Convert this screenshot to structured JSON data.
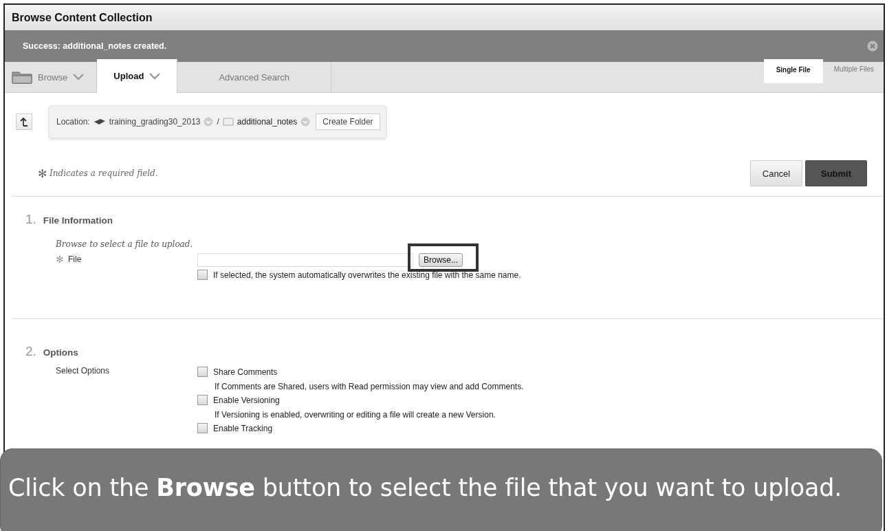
{
  "window": {
    "title": "Browse Content Collection"
  },
  "notification": {
    "message": "Success: additional_notes created.",
    "closable": true
  },
  "tabs": [
    {
      "label": "Browse",
      "selected": false,
      "dropdown": true
    },
    {
      "label": "Upload",
      "selected": true,
      "dropdown": true
    },
    {
      "label": "Advanced Search",
      "selected": false,
      "dropdown": false
    }
  ],
  "upload_modes": [
    {
      "label": "Single File",
      "selected": true
    },
    {
      "label": "Multiple Files",
      "selected": false
    }
  ],
  "location": {
    "label": "Location:",
    "separator": "/",
    "button": "Create Folder",
    "path": [
      {
        "name": "training_grading30_2013",
        "kind": "course"
      },
      {
        "name": "additional_notes",
        "kind": "folder"
      }
    ]
  },
  "required_note": {
    "mark": "✻",
    "text": "Indicates a required field."
  },
  "actions": [
    {
      "label": "Cancel",
      "kind": "secondary"
    },
    {
      "label": "Submit",
      "kind": "primary"
    }
  ],
  "sections": [
    {
      "number": "1.",
      "title": "File Information",
      "instructions": "Browse to select a file to upload.",
      "file_field": {
        "label": "File",
        "required": true,
        "button": "Browse...",
        "highlighted": true,
        "overwrite": {
          "label": "If selected, the system automatically overwrites the existing file with the same name.",
          "checked": false
        }
      }
    },
    {
      "number": "2.",
      "title": "Options",
      "options_label": "Select Options",
      "options": [
        {
          "label": "Share Comments",
          "checked": false,
          "description": "If Comments are Shared, users with Read permission may view and add Comments."
        },
        {
          "label": "Enable Versioning",
          "checked": false,
          "description": "If Versioning is enabled, overwriting or editing a file will create a new Version."
        },
        {
          "label": "Enable Tracking",
          "checked": false
        }
      ]
    }
  ],
  "caption": {
    "text": "Click on the **Browse** button to select the file that you want to upload."
  }
}
